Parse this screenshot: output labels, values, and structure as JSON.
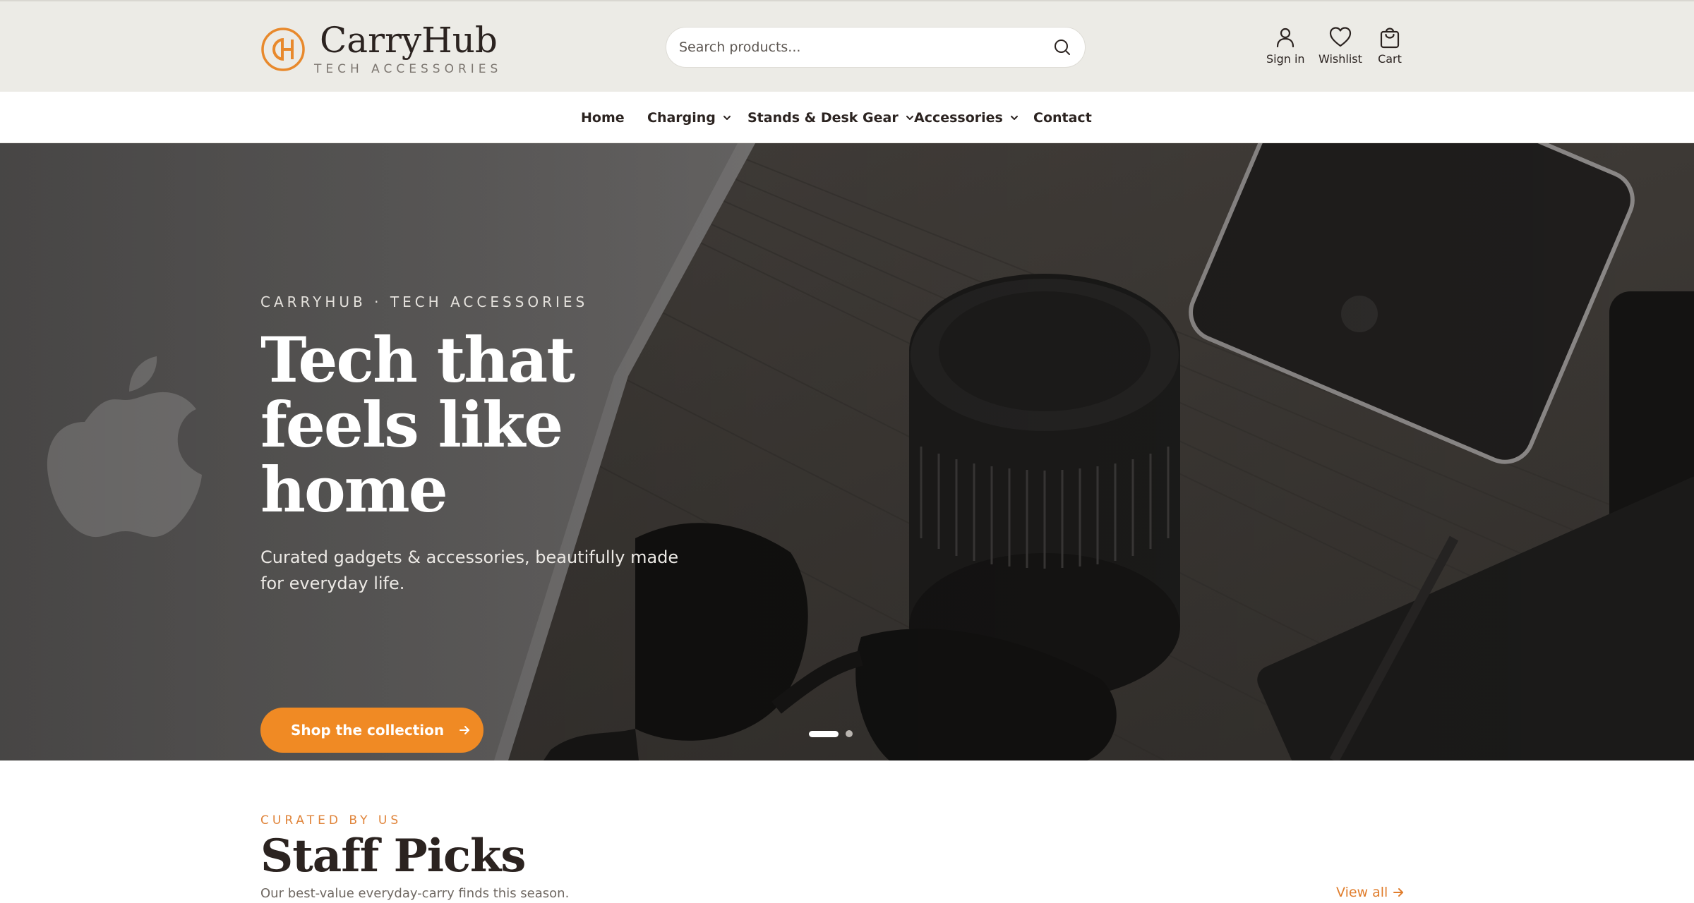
{
  "brand": {
    "name": "CarryHub",
    "tagline": "TECH ACCESSORIES",
    "logo_icon": "ch-monogram-logo",
    "accent_color": "#f08a24"
  },
  "search": {
    "placeholder": "Search products...",
    "icon": "search-icon"
  },
  "utility_nav": [
    {
      "label": "Sign in",
      "icon": "user-icon"
    },
    {
      "label": "Wishlist",
      "icon": "heart-icon"
    },
    {
      "label": "Cart",
      "icon": "shopping-bag-icon"
    }
  ],
  "main_nav": [
    {
      "label": "Home",
      "has_dropdown": false
    },
    {
      "label": "Charging",
      "has_dropdown": true
    },
    {
      "label": "Stands & Desk Gear",
      "has_dropdown": true
    },
    {
      "label": "Accessories",
      "has_dropdown": true
    },
    {
      "label": "Contact",
      "has_dropdown": false
    }
  ],
  "hero": {
    "eyebrow": "CARRYHUB · TECH ACCESSORIES",
    "title": "Tech that feels like home",
    "subtitle": "Curated gadgets & accessories, beautifully made for everyday life.",
    "cta_label": "Shop the collection",
    "slide_count": 2,
    "active_slide": 1
  },
  "staff_picks": {
    "eyebrow": "CURATED BY US",
    "title": "Staff Picks",
    "subtitle": "Our best-value everyday-carry finds this season.",
    "view_all_label": "View all"
  }
}
